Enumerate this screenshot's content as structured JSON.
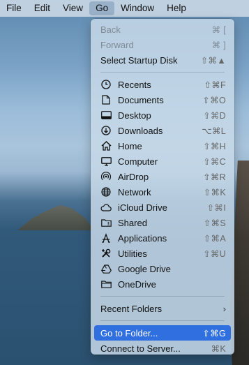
{
  "menubar": {
    "items": [
      "File",
      "Edit",
      "View",
      "Go",
      "Window",
      "Help"
    ]
  },
  "go_menu": {
    "group1": [
      {
        "label": "Back",
        "shortcut": "⌘ [",
        "enabled": false
      },
      {
        "label": "Forward",
        "shortcut": "⌘ ]",
        "enabled": false
      },
      {
        "label": "Select Startup Disk",
        "shortcut": "⇧⌘▲",
        "enabled": true
      }
    ],
    "places": [
      {
        "label": "Recents",
        "shortcut": "⇧⌘F",
        "icon": "clock-icon"
      },
      {
        "label": "Documents",
        "shortcut": "⇧⌘O",
        "icon": "document-icon"
      },
      {
        "label": "Desktop",
        "shortcut": "⇧⌘D",
        "icon": "desktop-icon"
      },
      {
        "label": "Downloads",
        "shortcut": "⌥⌘L",
        "icon": "download-icon"
      },
      {
        "label": "Home",
        "shortcut": "⇧⌘H",
        "icon": "home-icon"
      },
      {
        "label": "Computer",
        "shortcut": "⇧⌘C",
        "icon": "computer-icon"
      },
      {
        "label": "AirDrop",
        "shortcut": "⇧⌘R",
        "icon": "airdrop-icon"
      },
      {
        "label": "Network",
        "shortcut": "⇧⌘K",
        "icon": "network-icon"
      },
      {
        "label": "iCloud Drive",
        "shortcut": "⇧⌘I",
        "icon": "cloud-icon"
      },
      {
        "label": "Shared",
        "shortcut": "⇧⌘S",
        "icon": "shared-folder-icon"
      },
      {
        "label": "Applications",
        "shortcut": "⇧⌘A",
        "icon": "applications-icon"
      },
      {
        "label": "Utilities",
        "shortcut": "⇧⌘U",
        "icon": "utilities-icon"
      },
      {
        "label": "Google Drive",
        "shortcut": "",
        "icon": "google-drive-icon"
      },
      {
        "label": "OneDrive",
        "shortcut": "",
        "icon": "folder-icon"
      }
    ],
    "recent_folders": {
      "label": "Recent Folders",
      "chevron": "›"
    },
    "go_to_folder": {
      "label": "Go to Folder...",
      "shortcut": "⇧⌘G"
    },
    "connect_to_server": {
      "label": "Connect to Server...",
      "shortcut": "⌘K"
    }
  }
}
